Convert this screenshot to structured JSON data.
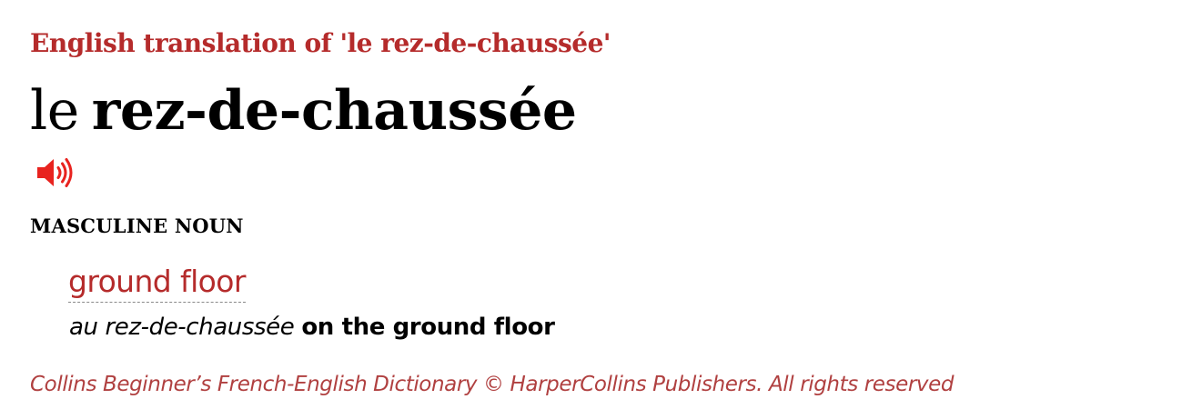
{
  "header": {
    "title": "English translation of  'le rez-de-chaussée'"
  },
  "headword": {
    "article": "le",
    "word": "rez-de-chaussée"
  },
  "audio": {
    "icon": "speaker-icon",
    "color": "#e8231f"
  },
  "entry": {
    "part_of_speech": "MASCULINE NOUN",
    "translation": "ground floor",
    "example_fr": "au rez-de-chaussée",
    "example_en": "on the ground floor"
  },
  "footer": {
    "copyright": "Collins Beginner’s French-English Dictionary © HarperCollins Publishers. All rights reserved"
  },
  "colors": {
    "accent": "#b52b2b",
    "audio": "#e8231f",
    "text": "#000000"
  }
}
